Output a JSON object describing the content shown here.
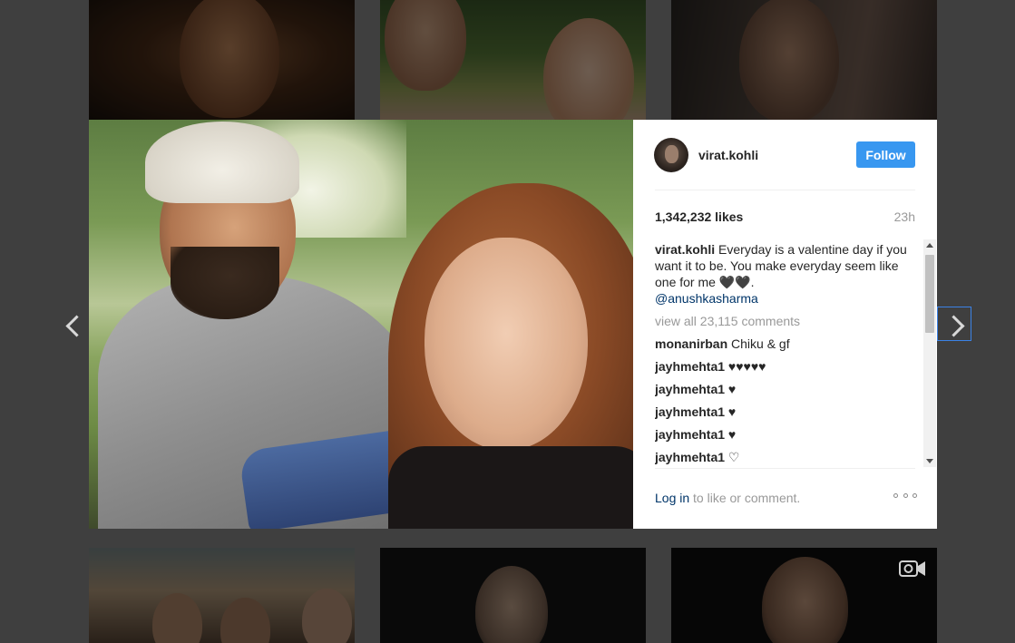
{
  "post": {
    "username": "virat.kohli",
    "follow_label": "Follow",
    "likes": "1,342,232 likes",
    "time_ago": "23h",
    "caption_user": "virat.kohli",
    "caption_text": " Everyday is a valentine day if you want it to be. You make everyday seem like one for me 🖤🖤.",
    "caption_mention": "@anushkasharma",
    "view_all": "view all 23,115 comments",
    "comments": [
      {
        "user": "monanirban",
        "text": " Chiku & gf"
      },
      {
        "user": "jayhmehta1",
        "text": " ♥♥♥♥♥"
      },
      {
        "user": "jayhmehta1",
        "text": " ♥"
      },
      {
        "user": "jayhmehta1",
        "text": " ♥"
      },
      {
        "user": "jayhmehta1",
        "text": " ♥"
      },
      {
        "user": "jayhmehta1",
        "text": " ♡"
      }
    ],
    "login_link": "Log in",
    "login_rest": " to like or comment."
  },
  "icons": {
    "prev": "chevron-left-icon",
    "next": "chevron-right-icon",
    "more": "more-options-icon",
    "video": "video-camera-icon"
  },
  "colors": {
    "follow_button": "#3897f0",
    "link": "#003569",
    "overlay": "#3f3f3f"
  }
}
